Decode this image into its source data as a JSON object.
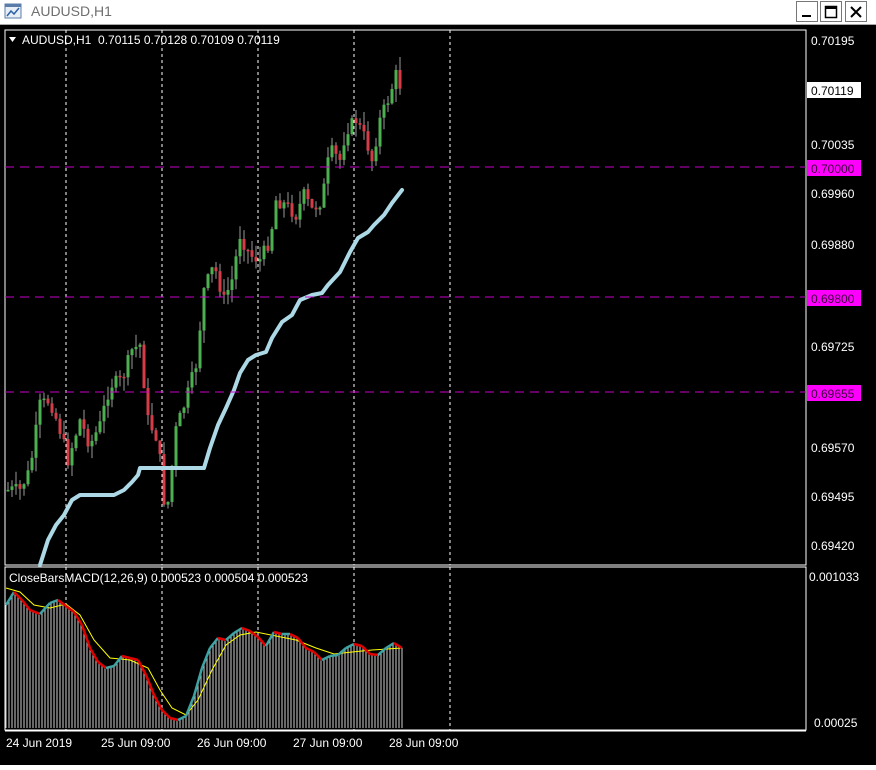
{
  "window": {
    "title": "AUDUSD,H1"
  },
  "main_chart": {
    "header": "AUDUSD,H1  0.70115 0.70128 0.70109 0.70119",
    "price_ticks": [
      "0.70195",
      "0.70035",
      "0.69960",
      "0.69880",
      "0.69725",
      "0.69570",
      "0.69495",
      "0.69420"
    ],
    "current_price": "0.70119",
    "levels": [
      {
        "label": "0.70000",
        "value": 0.7
      },
      {
        "label": "0.69800",
        "value": 0.698
      },
      {
        "label": "0.69655",
        "value": 0.69655
      }
    ]
  },
  "indicator": {
    "header": "CloseBarsMACD(12,26,9) 0.000523 0.000504 0.000523",
    "ticks": [
      "0.001033",
      "0.00025"
    ]
  },
  "time_axis": [
    "24 Jun 2019",
    "25 Jun 09:00",
    "26 Jun 09:00",
    "27 Jun 09:00",
    "28 Jun 09:00"
  ],
  "colors": {
    "background": "#000000",
    "bull_candle": "#4caf50",
    "bear_candle": "#d43c48",
    "moving_average": "#add8e6",
    "level_line": "#c800c8",
    "level_label_bg": "#ff00ff",
    "macd_signal": "#ffff00",
    "macd_up": "#3fa3a3",
    "macd_down": "#e00000"
  }
}
